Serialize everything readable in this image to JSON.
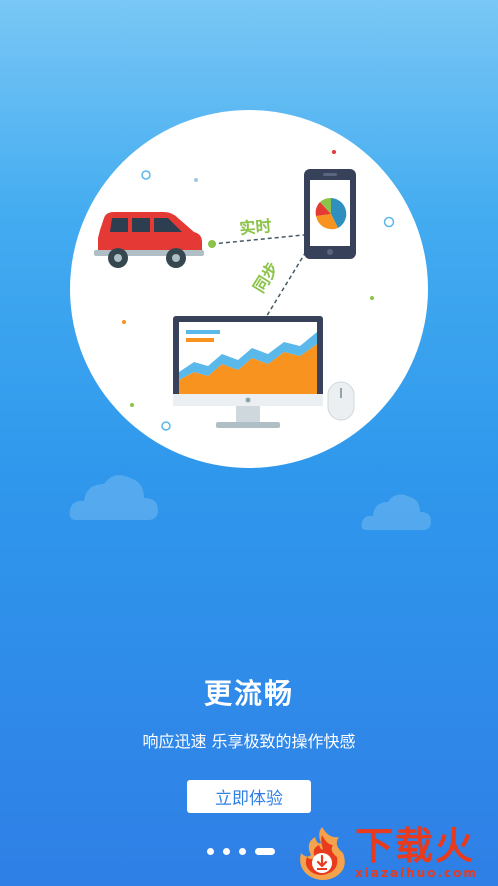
{
  "illustration": {
    "label_realtime": "实时",
    "label_sync": "同步",
    "accent_green": "#8bc34a",
    "car_color": "#e53935",
    "chart_orange": "#f7931e",
    "chart_teal": "#2f8fbf"
  },
  "content": {
    "title": "更流畅",
    "subtitle": "响应迅速 乐享极致的操作快感",
    "cta_label": "立即体验"
  },
  "pager": {
    "total": 4,
    "active_index": 3
  },
  "watermark": {
    "brand": "下载火",
    "domain": "xiazaihuo.com"
  },
  "colors": {
    "background_top": "#79c7f5",
    "background_bottom": "#2f7fe6",
    "brand_red": "#e83a1d"
  }
}
